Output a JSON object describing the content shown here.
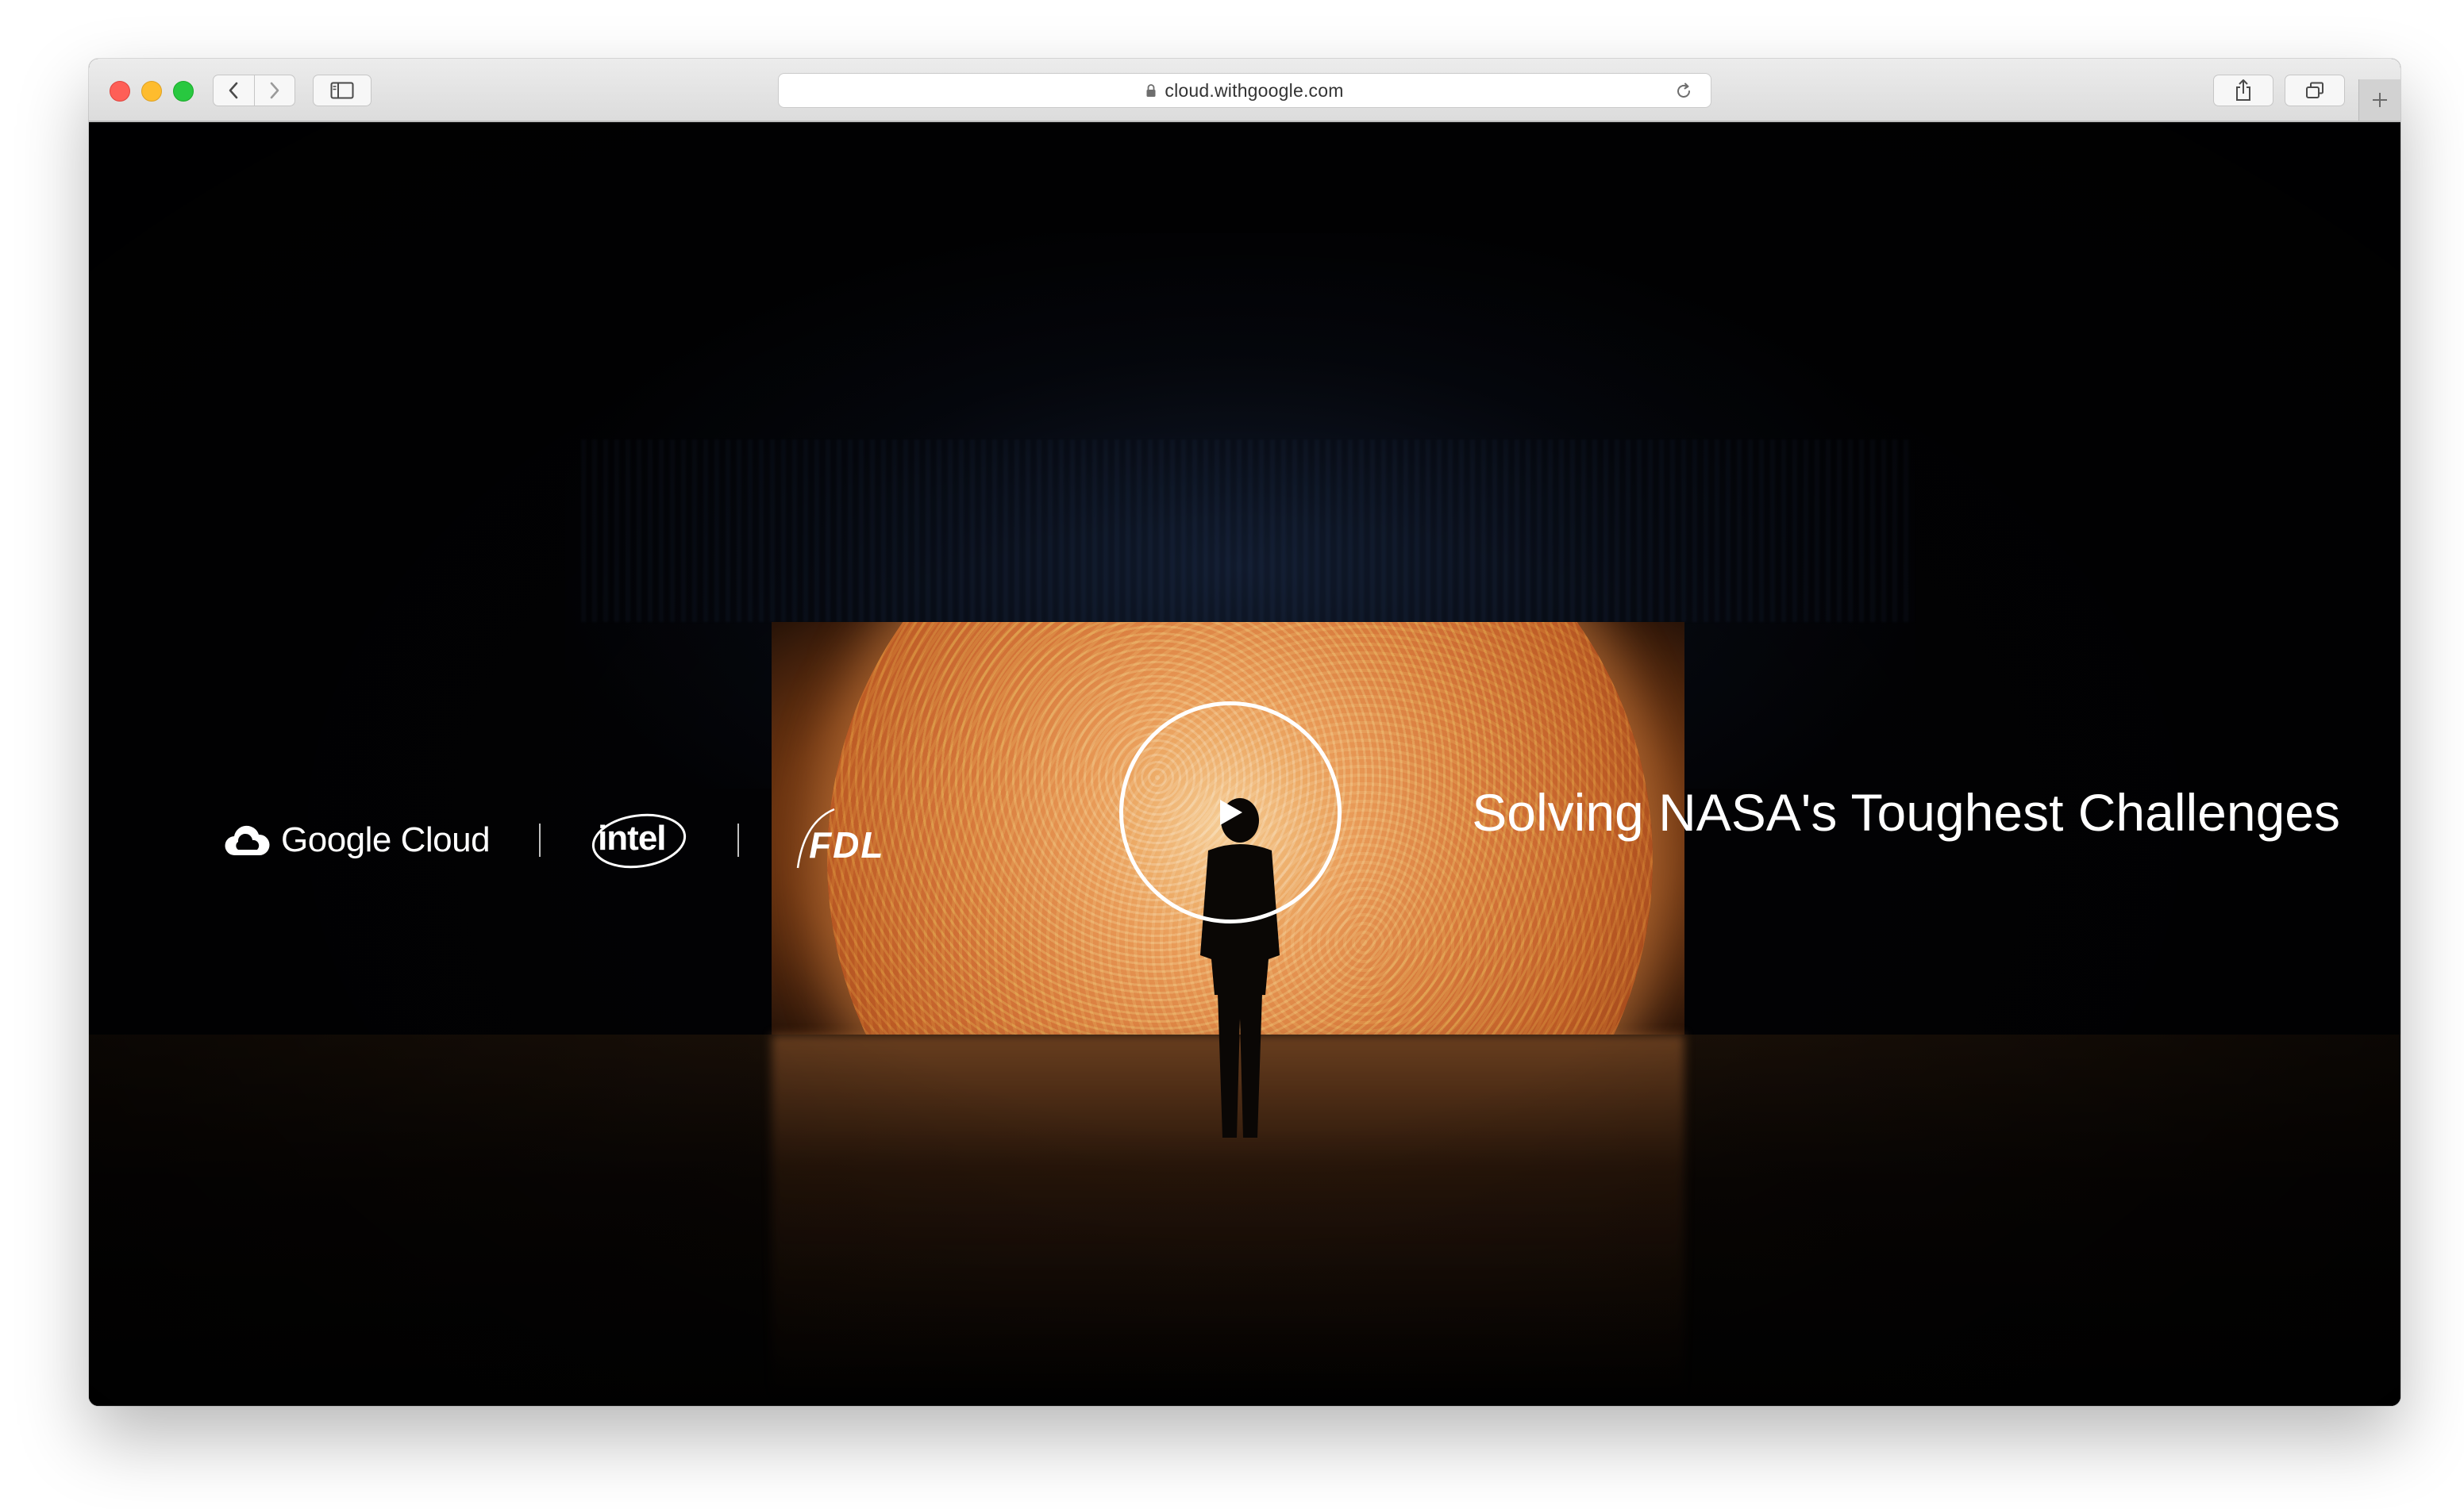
{
  "browser": {
    "url": "cloud.withgoogle.com",
    "icons": {
      "back": "chevron-left-icon",
      "forward": "chevron-right-icon",
      "sidebar": "sidebar-icon",
      "lock": "lock-icon",
      "reload": "reload-icon",
      "share": "share-icon",
      "tabs": "tabs-overview-icon",
      "new_tab": "plus-icon"
    },
    "traffic_lights": {
      "close": "#fe5f57",
      "minimize": "#febc2e",
      "zoom": "#28c840"
    }
  },
  "hero": {
    "partners": {
      "google_cloud": "Google Cloud",
      "intel": "intel",
      "fdl": "FDL"
    },
    "headline": "Solving NASA's Toughest Challenges",
    "play_icon": "play-icon",
    "colors": {
      "background": "#020204",
      "text": "#ffffff",
      "sun": "#e9a56a"
    }
  }
}
